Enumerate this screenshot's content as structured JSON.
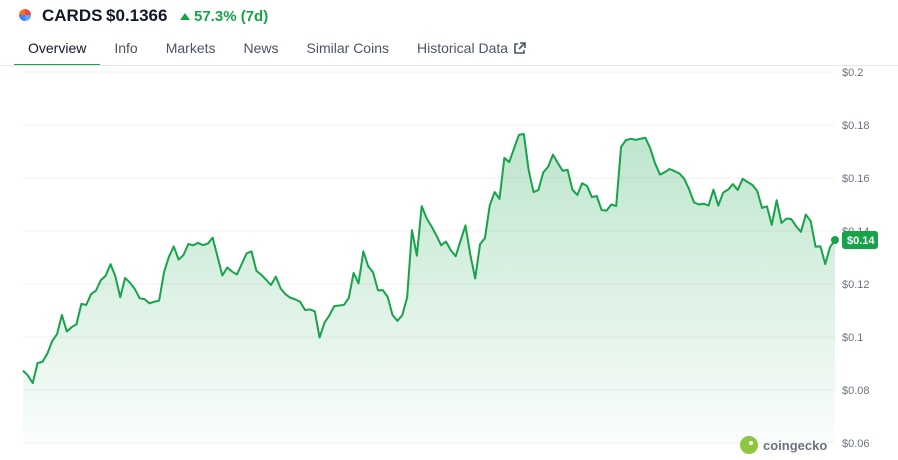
{
  "header": {
    "symbol": "CARDS",
    "price": "$0.1366",
    "change": "57.3% (7d)",
    "change_color": "#16a34a"
  },
  "tabs": [
    {
      "label": "Overview",
      "active": true
    },
    {
      "label": "Info"
    },
    {
      "label": "Markets"
    },
    {
      "label": "News"
    },
    {
      "label": "Similar Coins"
    },
    {
      "label": "Historical Data",
      "icon": "external-link-icon"
    }
  ],
  "watermark": "coingecko",
  "chart_data": {
    "type": "area",
    "title": "",
    "xlabel": "",
    "ylabel": "",
    "ylim": [
      0.06,
      0.2
    ],
    "y_ticks": [
      "$0.2",
      "$0.18",
      "$0.16",
      "$0.14",
      "$0.12",
      "$0.1",
      "$0.08",
      "$0.06"
    ],
    "y_tick_values": [
      0.2,
      0.18,
      0.16,
      0.14,
      0.12,
      0.1,
      0.08,
      0.06
    ],
    "last_value_label": "$0.14",
    "line_color": "#16a34a",
    "grid": true,
    "values": [
      0.0873,
      0.0855,
      0.0826,
      0.0902,
      0.0906,
      0.0937,
      0.0984,
      0.1011,
      0.1083,
      0.1021,
      0.1037,
      0.1048,
      0.1125,
      0.1121,
      0.1162,
      0.1175,
      0.1214,
      0.1231,
      0.1275,
      0.1229,
      0.115,
      0.1223,
      0.1205,
      0.1181,
      0.1146,
      0.1143,
      0.1127,
      0.1133,
      0.1137,
      0.1244,
      0.1302,
      0.1342,
      0.1292,
      0.1309,
      0.1351,
      0.1346,
      0.1355,
      0.1347,
      0.1352,
      0.1375,
      0.1304,
      0.1232,
      0.1262,
      0.1247,
      0.1236,
      0.1276,
      0.1316,
      0.1323,
      0.125,
      0.1235,
      0.1216,
      0.1196,
      0.1228,
      0.1183,
      0.1161,
      0.1148,
      0.1142,
      0.1133,
      0.1102,
      0.1104,
      0.1097,
      0.0998,
      0.1054,
      0.1081,
      0.1116,
      0.1119,
      0.1121,
      0.1147,
      0.1242,
      0.1202,
      0.1323,
      0.1267,
      0.1244,
      0.1176,
      0.1177,
      0.1151,
      0.1083,
      0.1061,
      0.1082,
      0.1149,
      0.1403,
      0.1307,
      0.1494,
      0.1448,
      0.1418,
      0.1384,
      0.1346,
      0.136,
      0.1327,
      0.1305,
      0.1364,
      0.1421,
      0.131,
      0.1221,
      0.135,
      0.1373,
      0.1497,
      0.1547,
      0.1521,
      0.1676,
      0.166,
      0.1712,
      0.1763,
      0.1766,
      0.1629,
      0.1547,
      0.1555,
      0.1621,
      0.1642,
      0.1688,
      0.1656,
      0.1627,
      0.1631,
      0.1556,
      0.1536,
      0.158,
      0.157,
      0.1528,
      0.1532,
      0.1479,
      0.1477,
      0.15,
      0.1494,
      0.1717,
      0.1743,
      0.1748,
      0.1744,
      0.1748,
      0.1752,
      0.1712,
      0.1655,
      0.1613,
      0.1622,
      0.1634,
      0.1626,
      0.1617,
      0.1597,
      0.1557,
      0.1508,
      0.15,
      0.1503,
      0.1496,
      0.1556,
      0.1496,
      0.1545,
      0.1556,
      0.1577,
      0.1555,
      0.1597,
      0.1585,
      0.1574,
      0.1551,
      0.1487,
      0.1493,
      0.1423,
      0.1516,
      0.143,
      0.1447,
      0.1445,
      0.1418,
      0.1397,
      0.1462,
      0.1437,
      0.1341,
      0.1342,
      0.1275,
      0.134,
      0.1366
    ]
  }
}
